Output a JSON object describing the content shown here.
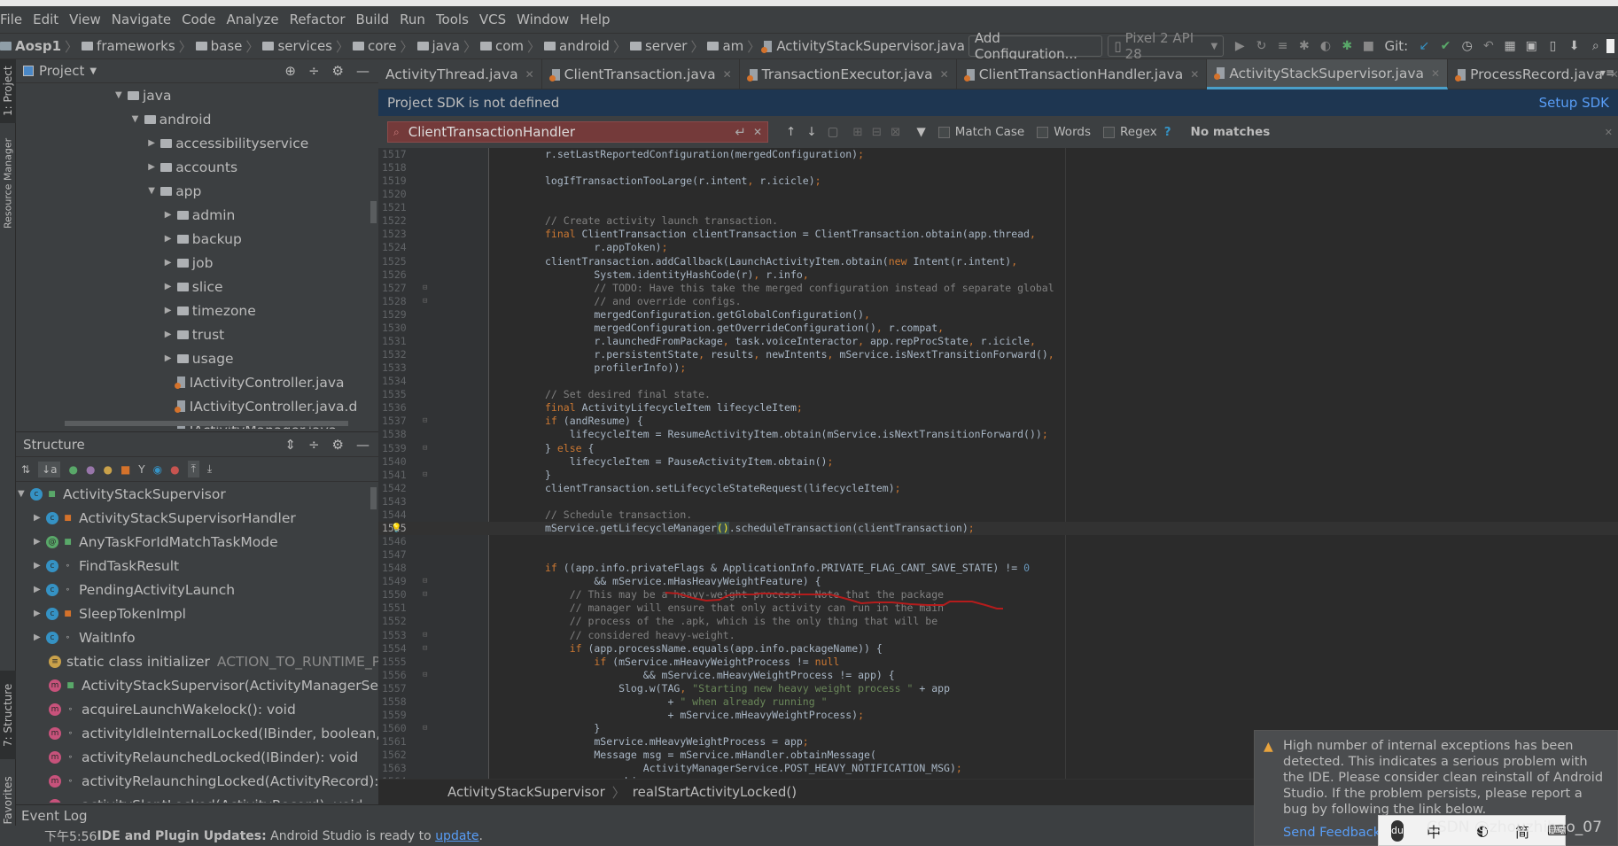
{
  "menu": [
    "File",
    "Edit",
    "View",
    "Navigate",
    "Code",
    "Analyze",
    "Refactor",
    "Build",
    "Run",
    "Tools",
    "VCS",
    "Window",
    "Help"
  ],
  "breadcrumb": [
    "Aosp1",
    "frameworks",
    "base",
    "services",
    "core",
    "java",
    "com",
    "android",
    "server",
    "am",
    "ActivityStackSupervisor.java"
  ],
  "toolbar": {
    "add_config": "Add Configuration...",
    "device": "Pixel 2 API 28",
    "git_label": "Git:"
  },
  "project": {
    "title": "Project",
    "tree": [
      {
        "label": "java",
        "level": 0,
        "arrow": "down",
        "icon": "folder"
      },
      {
        "label": "android",
        "level": 1,
        "arrow": "down",
        "icon": "folder"
      },
      {
        "label": "accessibilityservice",
        "level": 2,
        "arrow": "right",
        "icon": "folder"
      },
      {
        "label": "accounts",
        "level": 2,
        "arrow": "right",
        "icon": "folder"
      },
      {
        "label": "app",
        "level": 2,
        "arrow": "down",
        "icon": "folder"
      },
      {
        "label": "admin",
        "level": 3,
        "arrow": "right",
        "icon": "folder"
      },
      {
        "label": "backup",
        "level": 3,
        "arrow": "right",
        "icon": "folder"
      },
      {
        "label": "job",
        "level": 3,
        "arrow": "right",
        "icon": "folder"
      },
      {
        "label": "slice",
        "level": 3,
        "arrow": "right",
        "icon": "folder"
      },
      {
        "label": "timezone",
        "level": 3,
        "arrow": "right",
        "icon": "folder"
      },
      {
        "label": "trust",
        "level": 3,
        "arrow": "right",
        "icon": "folder"
      },
      {
        "label": "usage",
        "level": 3,
        "arrow": "right",
        "icon": "folder"
      },
      {
        "label": "IActivityController.java",
        "level": 3,
        "arrow": "",
        "icon": "java"
      },
      {
        "label": "IActivityController.java.d",
        "level": 3,
        "arrow": "",
        "icon": "java"
      },
      {
        "label": "IActivityManager.java",
        "level": 3,
        "arrow": "",
        "icon": "java"
      }
    ]
  },
  "structure": {
    "title": "Structure",
    "tree": [
      {
        "label": "ActivityStackSupervisor",
        "level": 0,
        "arrow": "down",
        "kind": "c",
        "vis": "public"
      },
      {
        "label": "ActivityStackSupervisorHandler",
        "level": 1,
        "arrow": "right",
        "kind": "c",
        "vis": "private"
      },
      {
        "label": "AnyTaskForIdMatchTaskMode",
        "level": 1,
        "arrow": "right",
        "kind": "@",
        "vis": "public"
      },
      {
        "label": "FindTaskResult",
        "level": 1,
        "arrow": "right",
        "kind": "c",
        "vis": "package"
      },
      {
        "label": "PendingActivityLaunch",
        "level": 1,
        "arrow": "right",
        "kind": "c",
        "vis": "package"
      },
      {
        "label": "SleepTokenImpl",
        "level": 1,
        "arrow": "right",
        "kind": "c",
        "vis": "private"
      },
      {
        "label": "WaitInfo",
        "level": 1,
        "arrow": "right",
        "kind": "c",
        "vis": "package"
      },
      {
        "label": "static class initializer",
        "extra": "ACTION_TO_RUNTIME_PE...",
        "level": 1,
        "arrow": "",
        "kind": "s",
        "vis": ""
      },
      {
        "label": "ActivityStackSupervisor(ActivityManagerService",
        "level": 1,
        "arrow": "",
        "kind": "m",
        "vis": "public"
      },
      {
        "label": "acquireLaunchWakelock(): void",
        "level": 1,
        "arrow": "",
        "kind": "m",
        "vis": "package"
      },
      {
        "label": "activityIdleInternalLocked(IBinder, boolean, bool",
        "level": 1,
        "arrow": "",
        "kind": "m",
        "vis": "package"
      },
      {
        "label": "activityRelaunchedLocked(IBinder): void",
        "level": 1,
        "arrow": "",
        "kind": "m",
        "vis": "package"
      },
      {
        "label": "activityRelaunchingLocked(ActivityRecord): void",
        "level": 1,
        "arrow": "",
        "kind": "m",
        "vis": "package"
      },
      {
        "label": "activitySleptLocked(ActivityRecord): void",
        "level": 1,
        "arrow": "",
        "kind": "m",
        "vis": "package"
      }
    ]
  },
  "side_tabs": {
    "project": "1: Project",
    "resource": "Resource Manager",
    "structure": "7: Structure",
    "favorites": "2: Favorites"
  },
  "tabs": [
    {
      "label": "ActivityThread.java",
      "active": false
    },
    {
      "label": "ClientTransaction.java",
      "active": false
    },
    {
      "label": "TransactionExecutor.java",
      "active": false
    },
    {
      "label": "ClientTransactionHandler.java",
      "active": false
    },
    {
      "label": "ActivityStackSupervisor.java",
      "active": true
    },
    {
      "label": "ProcessRecord.java",
      "active": false
    }
  ],
  "sdk_banner": {
    "text": "Project SDK is not defined",
    "action": "Setup SDK"
  },
  "find": {
    "query": "ClientTransactionHandler",
    "match_case": "Match Case",
    "words": "Words",
    "regex": "Regex",
    "help": "?",
    "result": "No matches"
  },
  "code": {
    "first_line": 1517,
    "current_line": 1545,
    "lines": [
      "r.setLastReportedConfiguration(mergedConfiguration);",
      "",
      "logIfTransactionTooLarge(r.intent, r.icicle);",
      "",
      "",
      "// Create activity launch transaction.",
      "final ClientTransaction clientTransaction = ClientTransaction.obtain(app.thread,",
      "        r.appToken);",
      "clientTransaction.addCallback(LaunchActivityItem.obtain(new Intent(r.intent),",
      "        System.identityHashCode(r), r.info,",
      "        // TODO: Have this take the merged configuration instead of separate global",
      "        // and override configs.",
      "        mergedConfiguration.getGlobalConfiguration(),",
      "        mergedConfiguration.getOverrideConfiguration(), r.compat,",
      "        r.launchedFromPackage, task.voiceInteractor, app.repProcState, r.icicle,",
      "        r.persistentState, results, newIntents, mService.isNextTransitionForward(),",
      "        profilerInfo));",
      "",
      "// Set desired final state.",
      "final ActivityLifecycleItem lifecycleItem;",
      "if (andResume) {",
      "    lifecycleItem = ResumeActivityItem.obtain(mService.isNextTransitionForward());",
      "} else {",
      "    lifecycleItem = PauseActivityItem.obtain();",
      "}",
      "clientTransaction.setLifecycleStateRequest(lifecycleItem);",
      "",
      "// Schedule transaction.",
      "mService.getLifecycleManager().scheduleTransaction(clientTransaction);",
      "",
      "",
      "if ((app.info.privateFlags & ApplicationInfo.PRIVATE_FLAG_CANT_SAVE_STATE) != 0",
      "        && mService.mHasHeavyWeightFeature) {",
      "    // This may be a heavy-weight process!  Note that the package",
      "    // manager will ensure that only activity can run in the main",
      "    // process of the .apk, which is the only thing that will be",
      "    // considered heavy-weight.",
      "    if (app.processName.equals(app.info.packageName)) {",
      "        if (mService.mHeavyWeightProcess != null",
      "                && mService.mHeavyWeightProcess != app) {",
      "            Slog.w(TAG, \"Starting new heavy weight process \" + app",
      "                    + \" when already running \"",
      "                    + mService.mHeavyWeightProcess);",
      "        }",
      "        mService.mHeavyWeightProcess = app;",
      "        Message msg = mService.mHandler.obtainMessage(",
      "                ActivityManagerService.POST_HEAVY_NOTIFICATION_MSG);",
      "        msg.obj = r;"
    ]
  },
  "editor_breadcrumb": [
    "ActivityStackSupervisor",
    "realStartActivityLocked()"
  ],
  "event_log": {
    "title": "Event Log"
  },
  "status": {
    "time": "下午5:56",
    "bold": "IDE and Plugin Updates:",
    "text": " Android Studio is ready to ",
    "link": "update",
    "end": "."
  },
  "notification": {
    "text": "High number of internal exceptions has been detected. This indicates a serious problem with the IDE. Please consider clean reinstall of Android Studio. If the problem persists, please report a bug by following the link below.",
    "action": "Send Feedback"
  },
  "ime": {
    "logo": "du",
    "items": [
      "中",
      "简"
    ]
  },
  "watermark": "CSDN @zhouzhihao_07",
  "colors": {
    "keyword": "#cc7832",
    "comment": "#808080",
    "string": "#6a8759",
    "number": "#6897bb",
    "accent": "#4a9fc9",
    "link": "#589df6",
    "warning": "#e8a33d"
  }
}
